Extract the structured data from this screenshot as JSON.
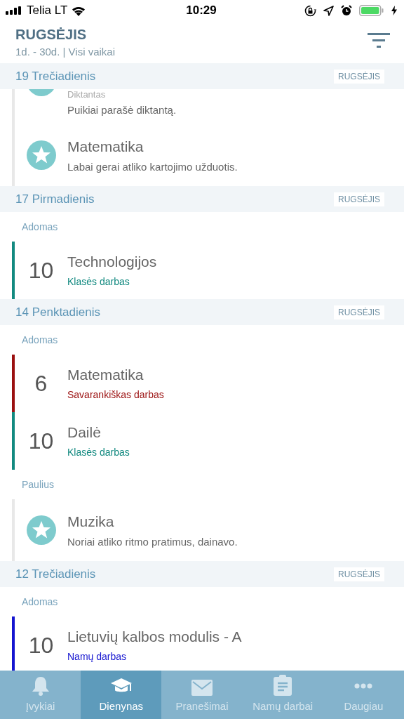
{
  "status_bar": {
    "carrier": "Telia LT",
    "time": "10:29"
  },
  "header": {
    "title": "RUGSĖJIS",
    "subtitle": "1d. - 30d. | Visi vaikai"
  },
  "days": [
    {
      "title": "19 Trečiadienis",
      "month": "RUGSĖJIS",
      "groups": [
        {
          "entries": [
            {
              "kind": "comment_cut",
              "label": "Diktantas",
              "comment": "Puikiai parašė diktantą."
            },
            {
              "kind": "comment",
              "subject": "Matematika",
              "comment": "Labai gerai atliko kartojimo užduotis."
            }
          ]
        }
      ]
    },
    {
      "title": "17 Pirmadienis",
      "month": "RUGSĖJIS",
      "groups": [
        {
          "child": "Adomas",
          "entries": [
            {
              "kind": "grade",
              "grade": "10",
              "subject": "Technologijos",
              "work": "Klasės darbas",
              "color": "#138a80"
            }
          ]
        }
      ]
    },
    {
      "title": "14 Penktadienis",
      "month": "RUGSĖJIS",
      "groups": [
        {
          "child": "Adomas",
          "entries": [
            {
              "kind": "grade",
              "grade": "6",
              "subject": "Matematika",
              "work": "Savarankiškas darbas",
              "color": "#9b1010"
            },
            {
              "kind": "grade",
              "grade": "10",
              "subject": "Dailė",
              "work": "Klasės darbas",
              "color": "#138a80"
            }
          ]
        },
        {
          "child": "Paulius",
          "entries": [
            {
              "kind": "comment",
              "subject": "Muzika",
              "comment": "Noriai atliko ritmo pratimus, dainavo."
            }
          ]
        }
      ]
    },
    {
      "title": "12 Trečiadienis",
      "month": "RUGSĖJIS",
      "groups": [
        {
          "child": "Adomas",
          "entries": [
            {
              "kind": "grade",
              "grade": "10",
              "subject": "Lietuvių kalbos modulis - A",
              "work": "Namų darbas",
              "color": "#1515d0"
            }
          ]
        }
      ]
    }
  ],
  "tabs": [
    {
      "label": "Įvykiai",
      "kind": "bell",
      "selected": false
    },
    {
      "label": "Dienynas",
      "kind": "cap",
      "selected": true
    },
    {
      "label": "Pranešimai",
      "kind": "mail",
      "selected": false
    },
    {
      "label": "Namų darbai",
      "kind": "clipboard",
      "selected": false
    },
    {
      "label": "Daugiau",
      "kind": "dots",
      "selected": false
    }
  ]
}
